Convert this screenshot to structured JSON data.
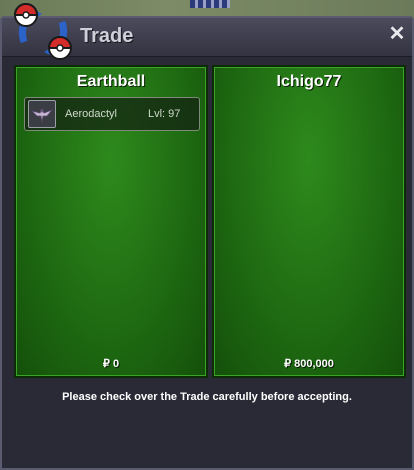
{
  "window": {
    "title": "Trade",
    "close_symbol": "✕"
  },
  "left_panel": {
    "player_name": "Earthball",
    "items": [
      {
        "name": "Aerodactyl",
        "level": "Lvl: 97",
        "icon": "aerodactyl-sprite-icon"
      }
    ],
    "money": "₽ 0"
  },
  "right_panel": {
    "player_name": "Ichigo77",
    "items": [],
    "money": "₽ 800,000"
  },
  "footer": {
    "note": "Please check over the Trade carefully before accepting."
  },
  "colors": {
    "panel_green": "#1f6b12",
    "window_bg": "#2a2a36",
    "title_text": "#cfcfda"
  }
}
